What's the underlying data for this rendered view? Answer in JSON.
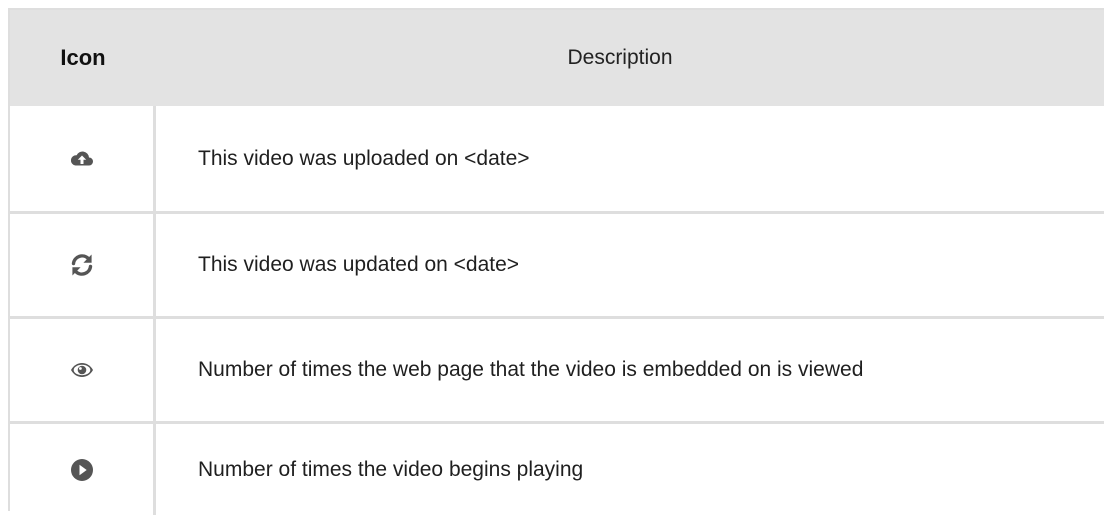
{
  "table": {
    "headers": {
      "icon": "Icon",
      "description": "Description"
    },
    "rows": [
      {
        "icon": "cloud-upload-icon",
        "description": "This video was uploaded on <date>"
      },
      {
        "icon": "refresh-icon",
        "description": "This video was updated on <date>"
      },
      {
        "icon": "eye-icon",
        "description": "Number of times the web page that the video is embedded on is viewed"
      },
      {
        "icon": "play-circle-icon",
        "description": "Number of times the video begins playing"
      }
    ]
  },
  "colors": {
    "header_bg": "#e3e3e3",
    "border": "#dedede",
    "icon": "#555555"
  }
}
